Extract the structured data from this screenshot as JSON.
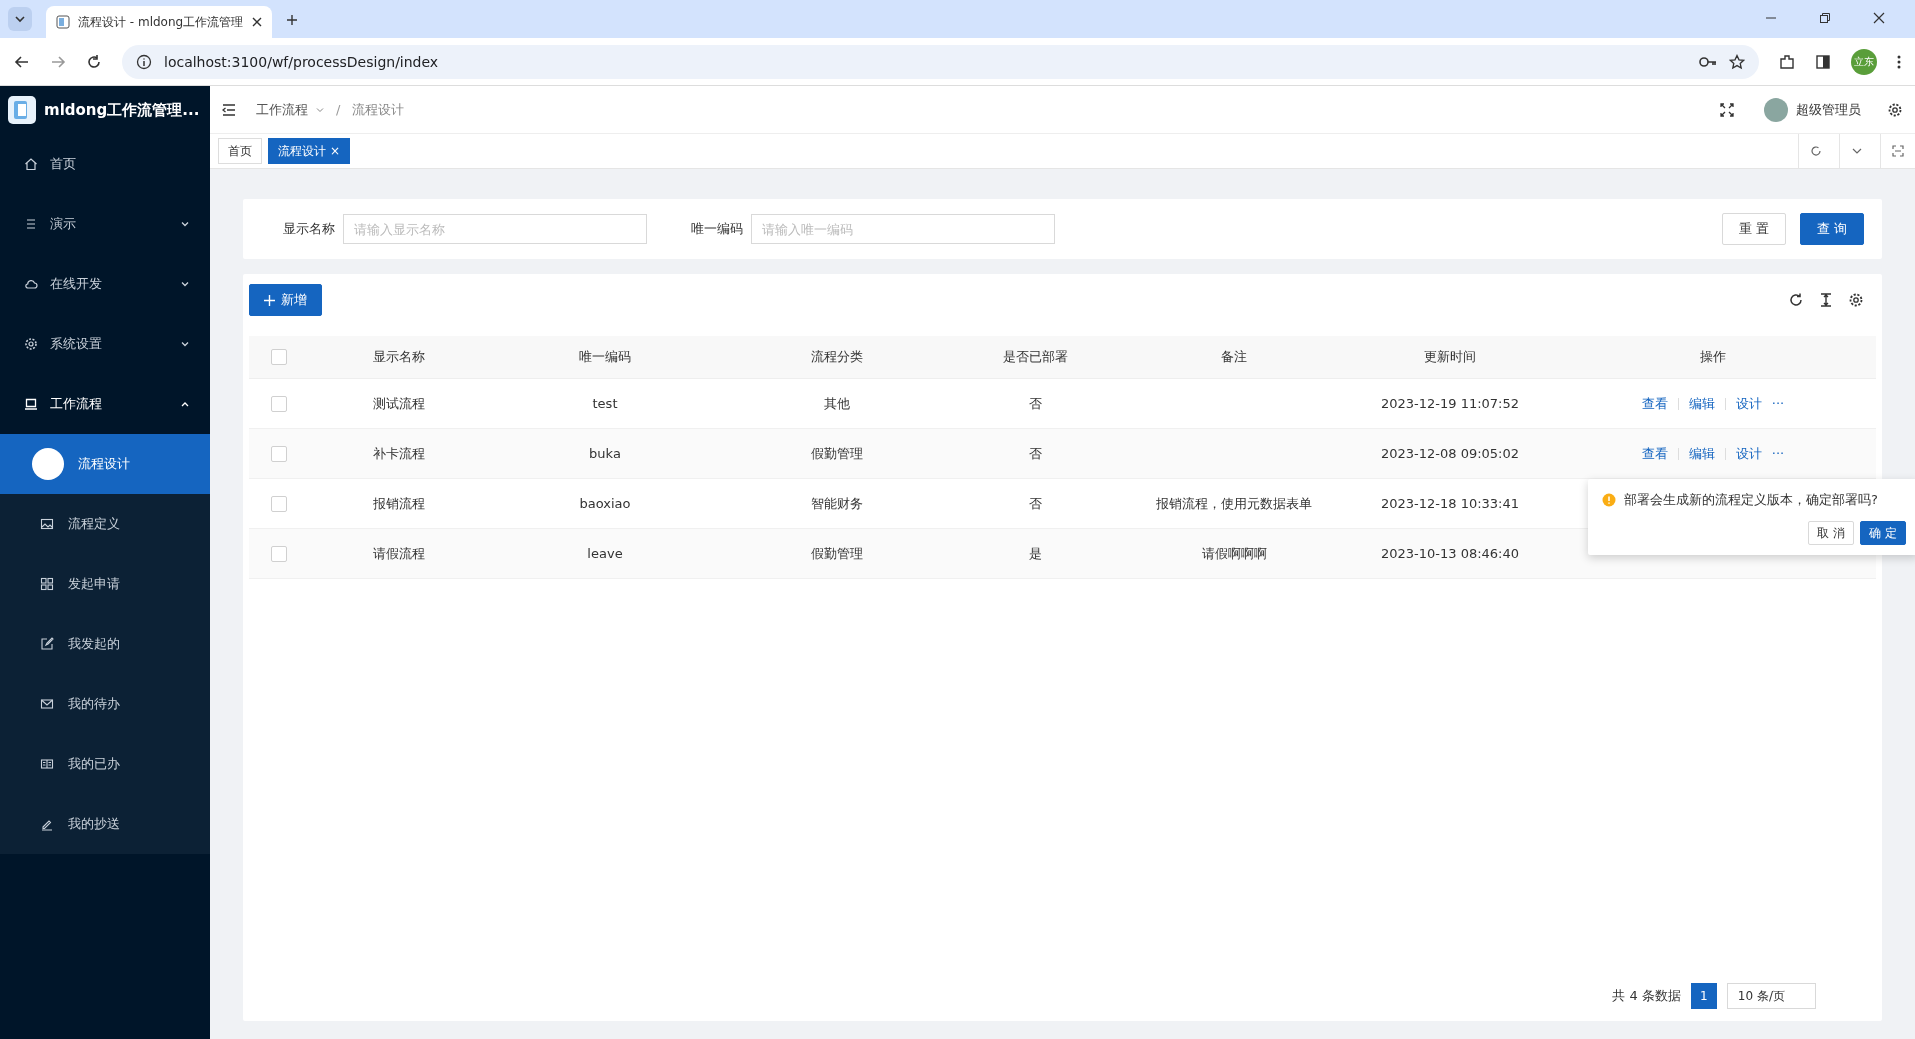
{
  "browser": {
    "tab_title": "流程设计 - mldong工作流管理",
    "url": "localhost:3100/wf/processDesign/index",
    "profile": "立东"
  },
  "app": {
    "name": "mldong工作流管理...",
    "breadcrumb": [
      "工作流程",
      "流程设计"
    ],
    "breadcrumb_separator": "/",
    "user": "超级管理员"
  },
  "sidebar": {
    "items": [
      {
        "label": "首页"
      },
      {
        "label": "演示",
        "expanded": false
      },
      {
        "label": "在线开发",
        "expanded": false
      },
      {
        "label": "系统设置",
        "expanded": false
      },
      {
        "label": "工作流程",
        "expanded": true,
        "children": [
          {
            "label": "流程设计",
            "selected": true
          },
          {
            "label": "流程定义",
            "selected": false
          },
          {
            "label": "发起申请",
            "selected": false
          },
          {
            "label": "我发起的",
            "selected": false
          },
          {
            "label": "我的待办",
            "selected": false
          },
          {
            "label": "我的已办",
            "selected": false
          },
          {
            "label": "我的抄送",
            "selected": false
          }
        ]
      }
    ]
  },
  "page_tabs": [
    {
      "label": "首页",
      "selected": false
    },
    {
      "label": "流程设计",
      "selected": true,
      "close": "×"
    }
  ],
  "search": {
    "fields": [
      {
        "label": "显示名称",
        "placeholder": "请输入显示名称"
      },
      {
        "label": "唯一编码",
        "placeholder": "请输入唯一编码"
      }
    ],
    "reset": "重 置",
    "submit": "查 询"
  },
  "toolbar": {
    "add": "新增"
  },
  "table": {
    "all_checked": false,
    "columns": [
      "显示名称",
      "唯一编码",
      "流程分类",
      "是否已部署",
      "备注",
      "更新时间",
      "操作"
    ],
    "rows": [
      {
        "checked": false,
        "cells": [
          "测试流程",
          "test",
          "其他",
          "否",
          "",
          "2023-12-19 11:07:52"
        ],
        "actions": [
          "查看",
          "编辑",
          "设计"
        ],
        "more": "···"
      },
      {
        "checked": false,
        "cells": [
          "补卡流程",
          "buka",
          "假勤管理",
          "否",
          "",
          "2023-12-08 09:05:02"
        ],
        "actions": [
          "查看",
          "编辑",
          "设计"
        ],
        "more": "···"
      },
      {
        "checked": false,
        "cells": [
          "报销流程",
          "baoxiao",
          "智能财务",
          "否",
          "报销流程，使用元数据表单",
          "2023-12-18 10:33:41"
        ],
        "actions": []
      },
      {
        "checked": false,
        "cells": [
          "请假流程",
          "leave",
          "假勤管理",
          "是",
          "请假啊啊啊",
          "2023-10-13 08:46:40"
        ],
        "actions": []
      }
    ]
  },
  "popconfirm": {
    "message": "部署会生成新的流程定义版本，确定部署吗?",
    "cancel": "取 消",
    "ok": "确 定"
  },
  "pagination": {
    "total": "共 4 条数据",
    "pages": [
      {
        "label": "1",
        "selected": true
      }
    ],
    "page_size": "10 条/页"
  }
}
